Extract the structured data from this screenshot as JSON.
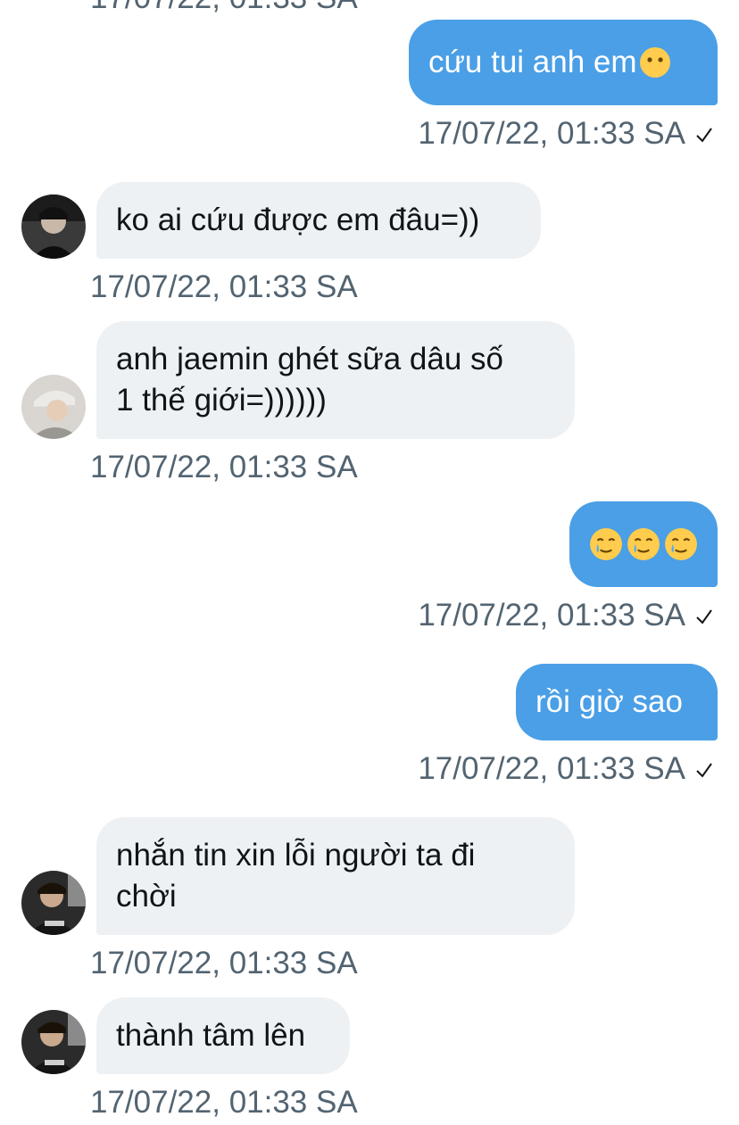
{
  "chat": {
    "cut_timestamp": "17/07/22, 01:33 SA",
    "messages": [
      {
        "dir": "out",
        "text": "cứu tui anh em",
        "emoji": "😶",
        "timestamp": "17/07/22, 01:33 SA"
      },
      {
        "dir": "in",
        "avatar": "avatar-1",
        "text": "ko ai cứu được em đâu=))",
        "timestamp": "17/07/22, 01:33 SA"
      },
      {
        "dir": "in",
        "avatar": "avatar-2",
        "line1": "anh jaemin ghét sữa dâu số",
        "line2": "1 thế giới=))))))",
        "timestamp": "17/07/22, 01:33 SA"
      },
      {
        "dir": "out",
        "text": "",
        "emoji": "🥲🥲🥲",
        "timestamp": "17/07/22, 01:33 SA"
      },
      {
        "dir": "out",
        "text": "rồi giờ sao",
        "timestamp": "17/07/22, 01:33 SA"
      },
      {
        "dir": "in",
        "avatar": "avatar-3",
        "line1": "nhắn tin xin lỗi người ta đi",
        "line2": "chời",
        "timestamp": "17/07/22, 01:33 SA"
      },
      {
        "dir": "in",
        "avatar": "avatar-3",
        "text": "thành tâm lên",
        "timestamp": "17/07/22, 01:33 SA"
      }
    ]
  },
  "icons": {
    "read_check": "check-icon",
    "avatar": "user-avatar"
  },
  "colors": {
    "outgoing_bubble": "#4a9fe6",
    "incoming_bubble": "#eef1f4",
    "timestamp": "#536471",
    "text": "#0f1419"
  }
}
